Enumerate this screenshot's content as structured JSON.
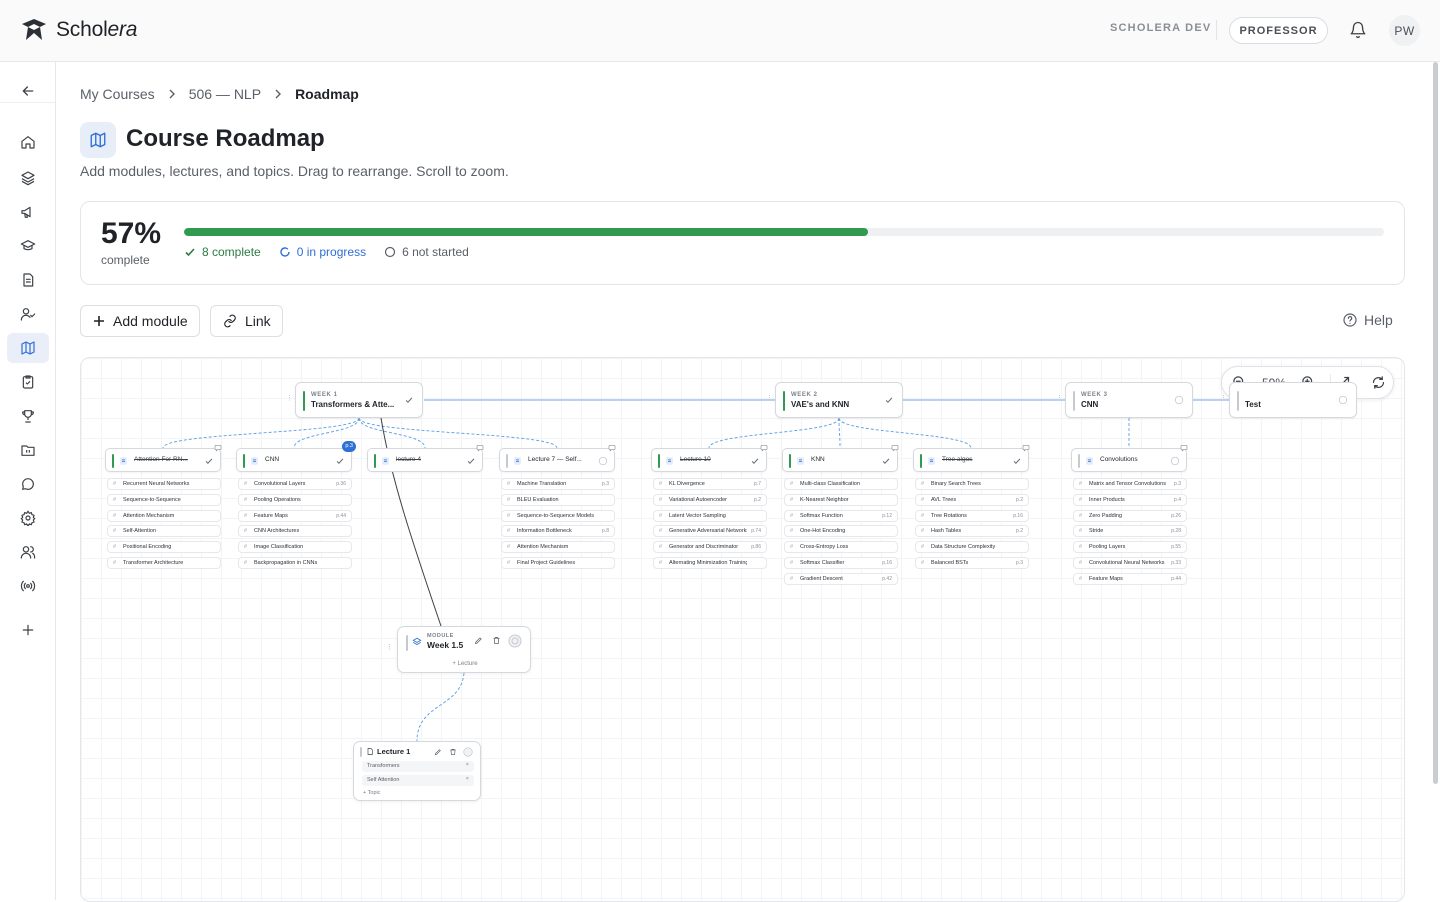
{
  "app": {
    "brand_prefix": "Schol",
    "brand_suffix": "era",
    "env": "SCHOLERA DEV",
    "role": "PROFESSOR",
    "avatar": "PW"
  },
  "sidebar": {
    "items": [
      "back",
      "home",
      "layers",
      "announcements",
      "courses",
      "documents",
      "people-check",
      "roadmap",
      "assignments",
      "trophy",
      "calendar",
      "chat",
      "settings",
      "users",
      "broadcast",
      "add"
    ],
    "active": "roadmap"
  },
  "breadcrumb": [
    "My Courses",
    "506 — NLP",
    "Roadmap"
  ],
  "page": {
    "title": "Course Roadmap",
    "subtitle": "Add modules, lectures, and topics. Drag to rearrange. Scroll to zoom."
  },
  "progress": {
    "percent_label": "57%",
    "percent": 57,
    "sub": "complete",
    "complete": "8 complete",
    "in_progress": "0 in progress",
    "not_started": "6 not started"
  },
  "toolbar": {
    "add_module": "Add module",
    "link": "Link",
    "help": "Help"
  },
  "zoom": {
    "value": "59%"
  },
  "colors": {
    "accent": "#2f6fd6",
    "complete": "#2f9a50",
    "edge": "#5b9be6"
  },
  "weeks": [
    {
      "label": "WEEK 1",
      "name": "Transformers & Atte...",
      "status": "complete"
    },
    {
      "label": "WEEK 2",
      "name": "VAE's and KNN",
      "status": "complete"
    },
    {
      "label": "WEEK 3",
      "name": "CNN",
      "status": "not-started"
    },
    {
      "label": "",
      "name": "Test",
      "status": "not-started"
    }
  ],
  "lectures": [
    {
      "name": "Attention For RN...",
      "strike": true,
      "status": "complete",
      "topics": [
        {
          "t": "Recurrent Neural Networks",
          "p": ""
        },
        {
          "t": "Sequence-to-Sequence",
          "p": ""
        },
        {
          "t": "Attention Mechanism",
          "p": ""
        },
        {
          "t": "Self-Attention",
          "p": ""
        },
        {
          "t": "Positional Encoding",
          "p": ""
        },
        {
          "t": "Transformer Architecture",
          "p": ""
        }
      ]
    },
    {
      "name": "CNN",
      "strike": false,
      "status": "complete",
      "badge": "p.3",
      "topics": [
        {
          "t": "Convolutional Layers",
          "p": "p.36"
        },
        {
          "t": "Pooling Operations",
          "p": ""
        },
        {
          "t": "Feature Maps",
          "p": "p.44"
        },
        {
          "t": "CNN Architectures",
          "p": ""
        },
        {
          "t": "Image Classification",
          "p": ""
        },
        {
          "t": "Backpropagation in CNNs",
          "p": ""
        }
      ]
    },
    {
      "name": "lecture 4",
      "strike": true,
      "status": "complete",
      "topics": []
    },
    {
      "name": "Lecture 7 — Self...",
      "strike": false,
      "status": "not-started",
      "topics": [
        {
          "t": "Machine Translation",
          "p": "p.3"
        },
        {
          "t": "BLEU Evaluation",
          "p": ""
        },
        {
          "t": "Sequence-to-Sequence Models",
          "p": ""
        },
        {
          "t": "Information Bottleneck",
          "p": "p.8"
        },
        {
          "t": "Attention Mechanism",
          "p": ""
        },
        {
          "t": "Final Project Guidelines",
          "p": ""
        }
      ]
    },
    {
      "name": "Lecture 10",
      "strike": true,
      "status": "complete",
      "topics": [
        {
          "t": "KL Divergence",
          "p": "p.7"
        },
        {
          "t": "Variational Autoencoder",
          "p": "p.2"
        },
        {
          "t": "Latent Vector Sampling",
          "p": ""
        },
        {
          "t": "Generative Adversarial Networks",
          "p": "p.74"
        },
        {
          "t": "Generator and Discriminator",
          "p": "p.86"
        },
        {
          "t": "Alternating Minimization Training",
          "p": ""
        }
      ]
    },
    {
      "name": "KNN",
      "strike": false,
      "status": "complete",
      "topics": [
        {
          "t": "Multi-class Classification",
          "p": ""
        },
        {
          "t": "K-Nearest Neighbor",
          "p": ""
        },
        {
          "t": "Softmax Function",
          "p": "p.12"
        },
        {
          "t": "One-Hot Encoding",
          "p": ""
        },
        {
          "t": "Cross-Entropy Loss",
          "p": ""
        },
        {
          "t": "Softmax Classifier",
          "p": "p.16"
        },
        {
          "t": "Gradient Descent",
          "p": "p.42"
        }
      ]
    },
    {
      "name": "Tree algos",
      "strike": true,
      "status": "complete",
      "topics": [
        {
          "t": "Binary Search Trees",
          "p": ""
        },
        {
          "t": "AVL Trees",
          "p": "p.2"
        },
        {
          "t": "Tree Rotations",
          "p": "p.16"
        },
        {
          "t": "Hash Tables",
          "p": "p.2"
        },
        {
          "t": "Data Structure Complexity",
          "p": ""
        },
        {
          "t": "Balanced BSTs",
          "p": "p.3"
        }
      ]
    },
    {
      "name": "Convolutions",
      "strike": false,
      "status": "not-started",
      "topics": [
        {
          "t": "Matrix and Tensor Convolutions",
          "p": "p.3"
        },
        {
          "t": "Inner Products",
          "p": "p.4"
        },
        {
          "t": "Zero Padding",
          "p": "p.26"
        },
        {
          "t": "Stride",
          "p": "p.28"
        },
        {
          "t": "Pooling Layers",
          "p": "p.55"
        },
        {
          "t": "Convolutional Neural Networks",
          "p": "p.33"
        },
        {
          "t": "Feature Maps",
          "p": "p.44"
        }
      ]
    }
  ],
  "module": {
    "label": "MODULE",
    "name": "Week 1.5",
    "add": "+ Lecture"
  },
  "lecture1": {
    "name": "Lecture 1",
    "topics": [
      "Transformers",
      "Self Attention"
    ],
    "add": "+ Topic"
  }
}
